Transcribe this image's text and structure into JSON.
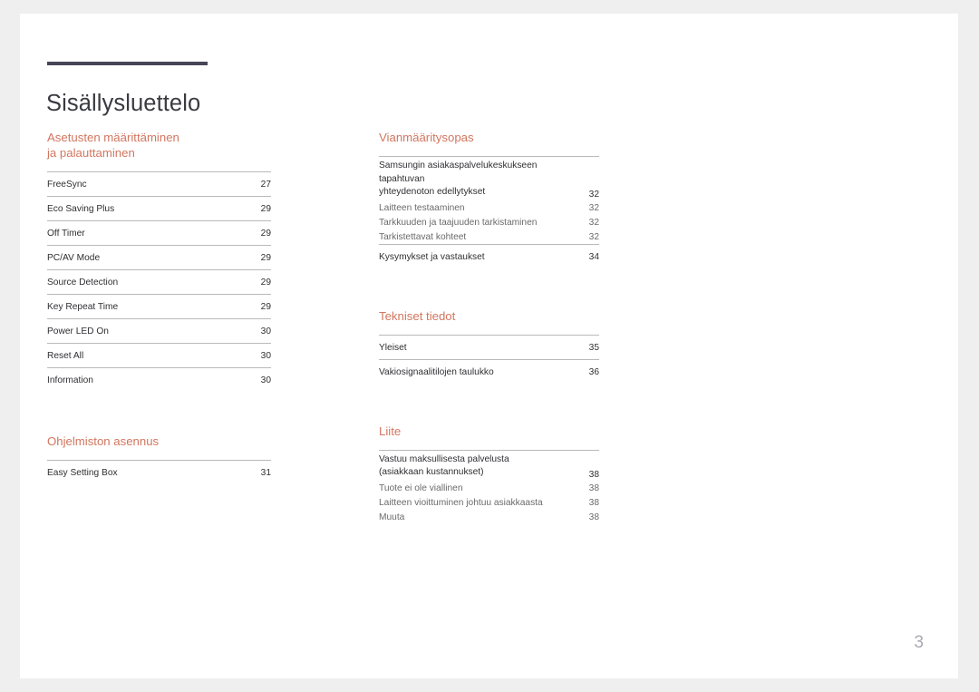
{
  "document": {
    "title": "Sisällysluettelo",
    "page_number": "3",
    "accent_color": "#d2765f",
    "rule_color": "#474559",
    "page_background": "#ffffff",
    "canvas_background": "#efeff0"
  },
  "left_column": {
    "sections": [
      {
        "heading": "Asetusten määrittäminen\nja palauttaminen",
        "entries": [
          {
            "label": "FreeSync",
            "page": "27",
            "style": "spaced"
          },
          {
            "label": "Eco Saving Plus",
            "page": "29",
            "style": "spaced"
          },
          {
            "label": "Off Timer",
            "page": "29",
            "style": "spaced"
          },
          {
            "label": "PC/AV Mode",
            "page": "29",
            "style": "spaced"
          },
          {
            "label": "Source Detection",
            "page": "29",
            "style": "spaced"
          },
          {
            "label": "Key Repeat Time",
            "page": "29",
            "style": "spaced"
          },
          {
            "label": "Power LED On",
            "page": "30",
            "style": "spaced"
          },
          {
            "label": "Reset All",
            "page": "30",
            "style": "spaced"
          },
          {
            "label": "Information",
            "page": "30",
            "style": "spaced"
          }
        ]
      },
      {
        "heading": "Ohjelmiston asennus",
        "entries": [
          {
            "label": "Easy Setting Box",
            "page": "31",
            "style": "spaced"
          }
        ]
      }
    ]
  },
  "right_column": {
    "sections": [
      {
        "heading": "Vianmääritysopas",
        "entries": [
          {
            "label": "Samsungin asiakaspalvelukeskukseen tapahtuvan\nyhteydenoton edellytykset",
            "page": "32",
            "style": "multiline"
          },
          {
            "label": "Laitteen testaaminen",
            "page": "32",
            "style": "sub"
          },
          {
            "label": "Tarkkuuden ja taajuuden tarkistaminen",
            "page": "32",
            "style": "sub"
          },
          {
            "label": "Tarkistettavat kohteet",
            "page": "32",
            "style": "sub"
          },
          {
            "label": "Kysymykset ja vastaukset",
            "page": "34",
            "style": "spaced"
          }
        ]
      },
      {
        "heading": "Tekniset tiedot",
        "entries": [
          {
            "label": "Yleiset",
            "page": "35",
            "style": "spaced"
          },
          {
            "label": "Vakiosignaalitilojen taulukko",
            "page": "36",
            "style": "spaced"
          }
        ]
      },
      {
        "heading": "Liite",
        "entries": [
          {
            "label": "Vastuu maksullisesta palvelusta\n(asiakkaan kustannukset)",
            "page": "38",
            "style": "multiline"
          },
          {
            "label": "Tuote ei ole viallinen",
            "page": "38",
            "style": "sub"
          },
          {
            "label": "Laitteen vioittuminen johtuu asiakkaasta",
            "page": "38",
            "style": "sub"
          },
          {
            "label": "Muuta",
            "page": "38",
            "style": "sub"
          }
        ]
      }
    ]
  }
}
